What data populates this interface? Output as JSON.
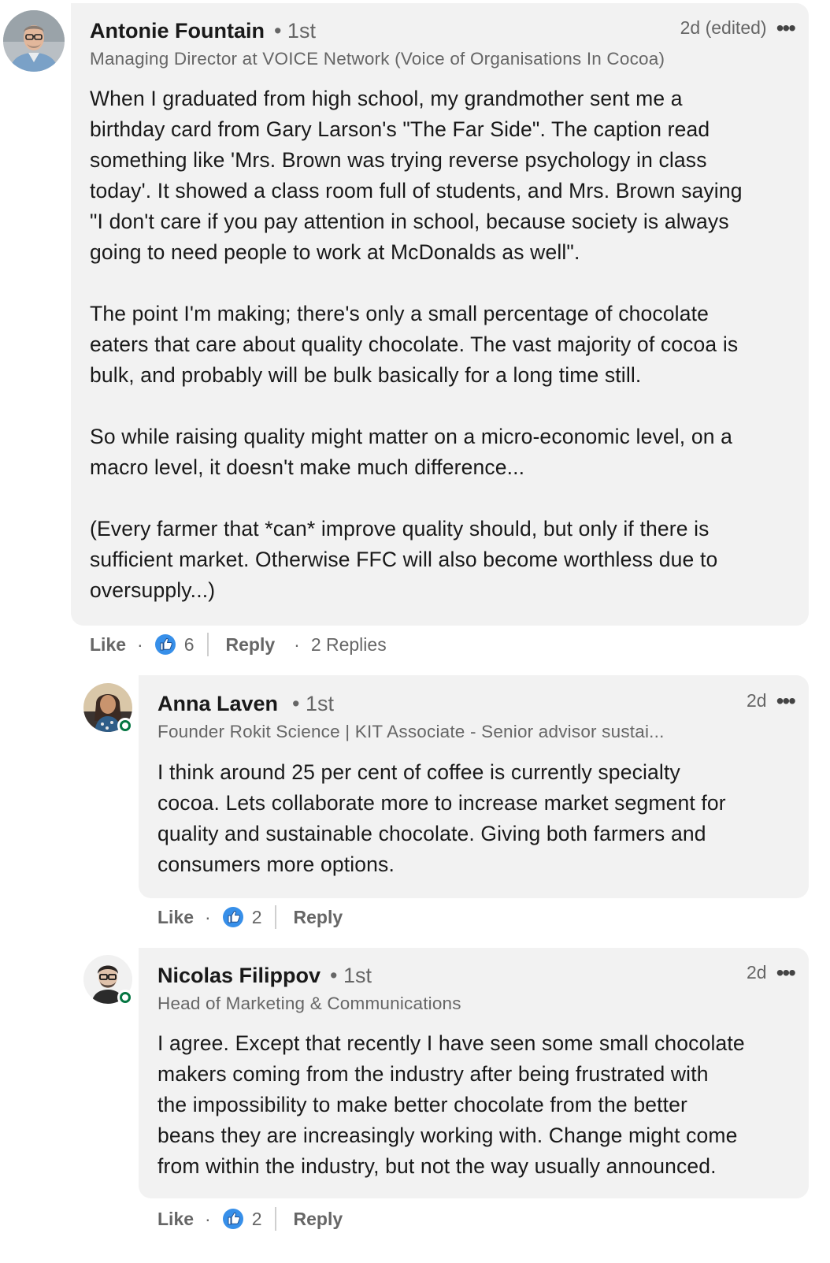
{
  "comments": [
    {
      "author": "Antonie Fountain",
      "degree": "• 1st",
      "headline": "Managing Director at VOICE Network (Voice of Organisations In Cocoa)",
      "timestamp": "2d (edited)",
      "more": "•••",
      "body": "When I graduated from high school, my grandmother sent me a\nbirthday card from Gary Larson's \"The Far Side\". The caption read\nsomething like 'Mrs. Brown was trying reverse psychology in class\ntoday'. It showed a class room full of students, and Mrs. Brown saying\n\"I don't care if you pay attention in school, because society is always\ngoing to need people to work at McDonalds as well\".\n\nThe point I'm making; there's only a small percentage of chocolate\neaters that care about quality chocolate. The vast majority of cocoa is\nbulk, and probably will be bulk basically for a long time still.\n\nSo while raising quality might matter on a micro-economic level, on a\nmacro level, it doesn't make much difference...\n\n(Every farmer that *can* improve quality should, but only if there is\nsufficient market. Otherwise FFC will also become worthless due to\noversupply...)",
      "like_label": "Like",
      "separator": "·",
      "reaction_count": "6",
      "reply_label": "Reply",
      "replies_label": "2 Replies"
    },
    {
      "author": "Anna Laven",
      "degree": "• 1st",
      "headline": "Founder Rokit Science | KIT Associate - Senior advisor sustai...",
      "timestamp": "2d",
      "more": "•••",
      "body": "I think around 25 per cent of coffee is currently specialty\ncocoa. Lets collaborate more to increase market segment for\nquality and sustainable chocolate. Giving both farmers and\nconsumers more options.",
      "like_label": "Like",
      "separator": "·",
      "reaction_count": "2",
      "reply_label": "Reply"
    },
    {
      "author": "Nicolas Filippov",
      "degree": "• 1st",
      "headline": "Head of Marketing & Communications",
      "timestamp": "2d",
      "more": "•••",
      "body": "I agree. Except that recently I have seen some small chocolate\nmakers coming from the industry after being frustrated with\nthe impossibility to make better chocolate from the better\nbeans they are increasingly working with. Change might come\nfrom within the industry, but not the way usually announced.",
      "like_label": "Like",
      "separator": "·",
      "reaction_count": "2",
      "reply_label": "Reply"
    }
  ],
  "icons": {
    "like": "like-thumb-icon",
    "presence": "online-status-icon",
    "more": "more-options-icon"
  },
  "colors": {
    "bubble": "#f2f2f2",
    "like_blue": "#378fe9",
    "online_green": "#057642",
    "secondary_text": "#666666"
  }
}
